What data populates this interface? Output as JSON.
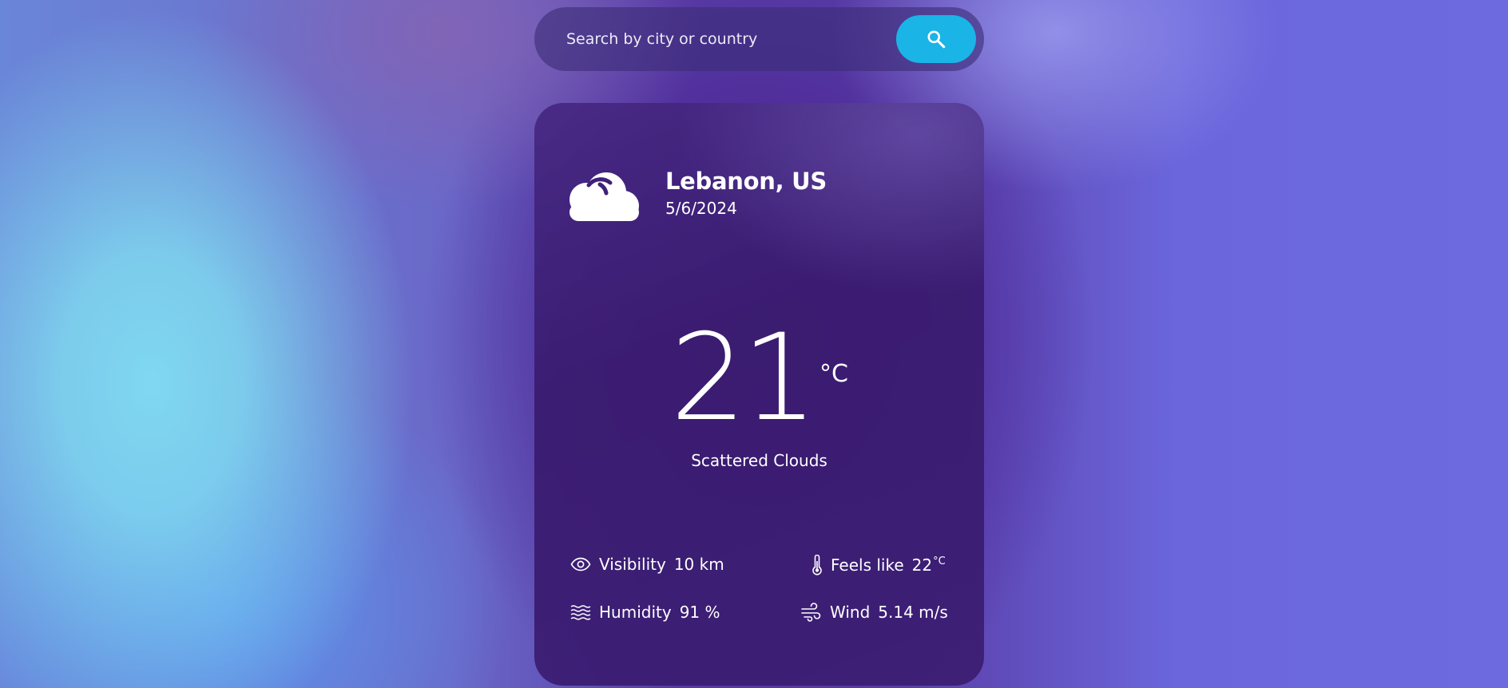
{
  "search": {
    "placeholder": "Search by city or country",
    "button_icon": "search-icon",
    "button_color": "#1ab4e6"
  },
  "weather": {
    "icon": "cloud-icon",
    "city": "Lebanon, US",
    "date": "5/6/2024",
    "temperature": "21",
    "unit": "°C",
    "condition": "Scattered Clouds"
  },
  "details": {
    "visibility": {
      "icon": "eye-icon",
      "label": "Visibility",
      "value": "10 km"
    },
    "feels_like": {
      "icon": "thermometer-icon",
      "label": "Feels like",
      "value": "22",
      "unit": "°C"
    },
    "humidity": {
      "icon": "humidity-icon",
      "label": "Humidity",
      "value": "91 %"
    },
    "wind": {
      "icon": "wind-icon",
      "label": "Wind",
      "value": "5.14 m/s"
    }
  }
}
